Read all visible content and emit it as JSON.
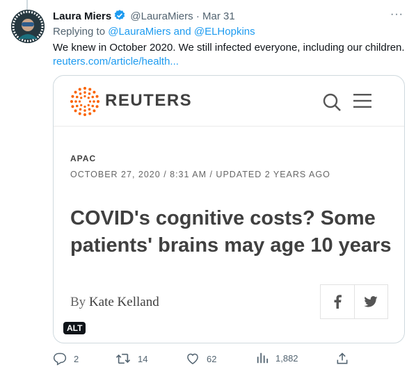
{
  "tweet": {
    "name": "Laura Miers",
    "handle": "@LauraMiers",
    "date": "· Mar 31",
    "more": "···",
    "replying_prefix": "Replying to",
    "replying_to_1": "@LauraMiers",
    "replying_and": "and",
    "replying_to_2": "@ELHopkins",
    "text": "We knew in October 2020. We still infected everyone, including our children.",
    "link": "reuters.com/article/health..."
  },
  "card": {
    "brand": "REUTERS",
    "section": "APAC",
    "date": "OCTOBER 27, 2020 / 8:31 AM / UPDATED 2 YEARS AGO",
    "headline_line1": "COVID's cognitive costs? Some",
    "headline_line2": "patients' brains may age 10 years",
    "byline_prefix": "By",
    "byline_author": "Kate Kelland",
    "alt_badge": "ALT"
  },
  "actions": {
    "reply_count": "2",
    "retweet_count": "14",
    "like_count": "62",
    "views_count": "1,882"
  },
  "colors": {
    "accent": "#1d9bf0",
    "muted": "#536471",
    "reuters_orange": "#fa6400"
  }
}
